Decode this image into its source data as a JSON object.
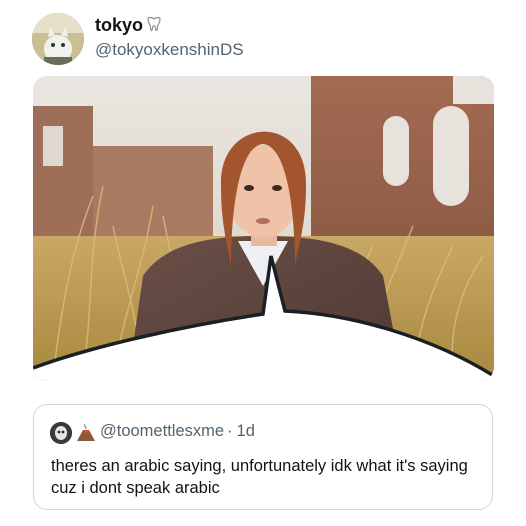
{
  "tweet": {
    "display_name": "tokyo",
    "handle": "@tokyoxkenshinDS",
    "badge_icon": "tooth-icon",
    "avatar_icon": "cat-avatar-icon"
  },
  "media": {
    "description_icon": "photo-speech-bubble-icon"
  },
  "quoted_tweet": {
    "handle": "@toomettlesxme",
    "separator": "·",
    "time": "1d",
    "emoji_icon": "volcano-icon",
    "avatar_icon": "profile-avatar-icon",
    "text": "theres an arabic saying, unfortunately idk what it's saying cuz i dont speak arabic"
  },
  "colors": {
    "text_primary": "#0f1419",
    "text_secondary": "#536471",
    "border": "#cfd9de"
  }
}
